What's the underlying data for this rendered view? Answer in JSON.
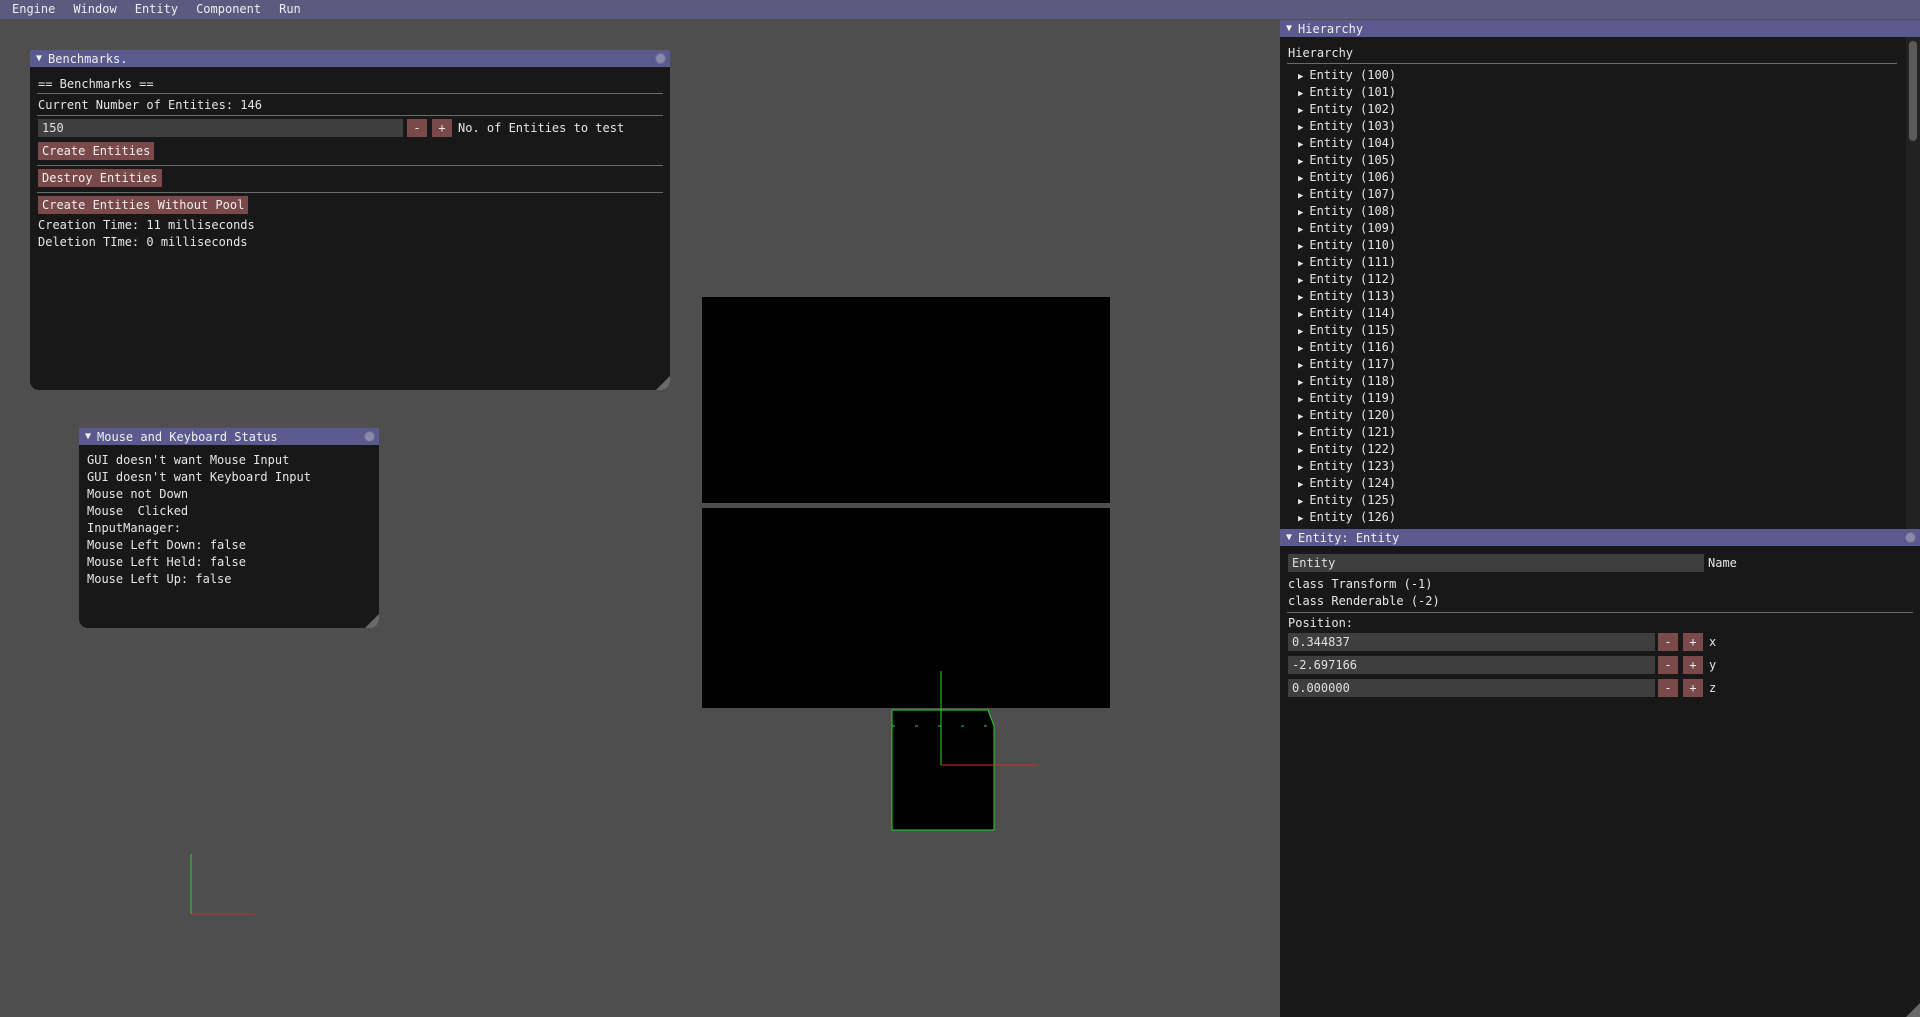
{
  "menubar": {
    "items": [
      "Engine",
      "Window",
      "Entity",
      "Component",
      "Run"
    ]
  },
  "benchmarks": {
    "title": "Benchmarks.",
    "heading": "== Benchmarks ==",
    "current_count": "Current Number of Entities: 146",
    "entity_input_value": "150",
    "minus_label": "-",
    "plus_label": "+",
    "input_label": "No. of Entities to test",
    "create_button": "Create Entities",
    "destroy_button": "Destroy Entities",
    "create_no_pool_button": "Create Entities Without Pool",
    "creation_time": "Creation Time: 11 milliseconds",
    "deletion_time": "Deletion TIme: 0 milliseconds"
  },
  "status": {
    "title": "Mouse and Keyboard Status",
    "lines": [
      "GUI doesn't want Mouse Input",
      "GUI doesn't want Keyboard Input",
      "Mouse not Down",
      "Mouse  Clicked",
      "InputManager:",
      "Mouse Left Down: false",
      "Mouse Left Held: false",
      "Mouse Left Up: false"
    ]
  },
  "hierarchy": {
    "title": "Hierarchy",
    "header": "Hierarchy",
    "items": [
      "Entity (100)",
      "Entity (101)",
      "Entity (102)",
      "Entity (103)",
      "Entity (104)",
      "Entity (105)",
      "Entity (106)",
      "Entity (107)",
      "Entity (108)",
      "Entity (109)",
      "Entity (110)",
      "Entity (111)",
      "Entity (112)",
      "Entity (113)",
      "Entity (114)",
      "Entity (115)",
      "Entity (116)",
      "Entity (117)",
      "Entity (118)",
      "Entity (119)",
      "Entity (120)",
      "Entity (121)",
      "Entity (122)",
      "Entity (123)",
      "Entity (124)",
      "Entity (125)",
      "Entity (126)"
    ]
  },
  "inspector": {
    "title": "Entity: Entity",
    "name_value": "Entity",
    "name_label": "Name",
    "components": [
      "class Transform (-1)",
      "class Renderable (-2)"
    ],
    "position_label": "Position:",
    "position": [
      {
        "value": "0.344837",
        "axis": "x"
      },
      {
        "value": "-2.697166",
        "axis": "y"
      },
      {
        "value": "0.000000",
        "axis": "z"
      }
    ],
    "minus_label": "-",
    "plus_label": "+"
  }
}
